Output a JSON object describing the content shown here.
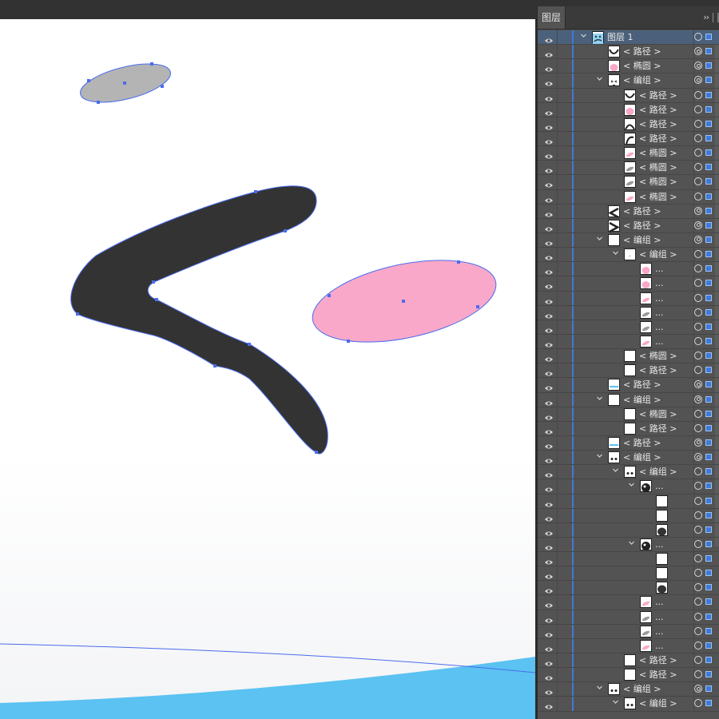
{
  "panel": {
    "tab_label": "图层",
    "menu_glyph": "››",
    "colors": {
      "selected_row": "#4b607a",
      "layer_color": "#3e7bd6",
      "panel_bg": "#535353"
    }
  },
  "canvas": {
    "colors": {
      "dark_stroke": "#333333",
      "pink_blush": "#f9a8c9",
      "gray_ellipse": "#b4b4b4",
      "sky_blue": "#5bc2f2",
      "path_outline": "#4a6cf0"
    }
  },
  "layers": [
    {
      "label": "图层 1",
      "indent": 0,
      "chev": "v",
      "thumb": "layer",
      "target": "single",
      "selected": true
    },
    {
      "label": "< 路径 >",
      "indent": 1,
      "chev": "",
      "thumb": "curve",
      "target": "double"
    },
    {
      "label": "< 椭圆 >",
      "indent": 1,
      "chev": "",
      "thumb": "pink",
      "target": "double"
    },
    {
      "label": "< 编组 >",
      "indent": 1,
      "chev": "v",
      "thumb": "face",
      "target": "double"
    },
    {
      "label": "< 路径 >",
      "indent": 2,
      "chev": "",
      "thumb": "curve",
      "target": "single"
    },
    {
      "label": "< 路径 >",
      "indent": 2,
      "chev": "",
      "thumb": "pink",
      "target": "single"
    },
    {
      "label": "< 路径 >",
      "indent": 2,
      "chev": "",
      "thumb": "arc",
      "target": "single"
    },
    {
      "label": "< 路径 >",
      "indent": 2,
      "chev": "",
      "thumb": "arc2",
      "target": "single"
    },
    {
      "label": "< 椭圆 >",
      "indent": 2,
      "chev": "",
      "thumb": "pinkslash",
      "target": "single"
    },
    {
      "label": "< 椭圆 >",
      "indent": 2,
      "chev": "",
      "thumb": "grayslash",
      "target": "single"
    },
    {
      "label": "< 椭圆 >",
      "indent": 2,
      "chev": "",
      "thumb": "grayslash",
      "target": "single"
    },
    {
      "label": "< 椭圆 >",
      "indent": 2,
      "chev": "",
      "thumb": "pinkslash",
      "target": "single"
    },
    {
      "label": "< 路径 >",
      "indent": 1,
      "chev": "",
      "thumb": "chevL",
      "target": "double"
    },
    {
      "label": "< 路径 >",
      "indent": 1,
      "chev": "",
      "thumb": "chevR",
      "target": "double"
    },
    {
      "label": "< 编组 >",
      "indent": 1,
      "chev": "v",
      "thumb": "blank",
      "target": "double"
    },
    {
      "label": "< 编组 >",
      "indent": 2,
      "chev": "v",
      "thumb": "dot",
      "target": "single"
    },
    {
      "label": "...",
      "indent": 3,
      "chev": "",
      "thumb": "pink",
      "target": "single"
    },
    {
      "label": "...",
      "indent": 3,
      "chev": "",
      "thumb": "pink",
      "target": "single"
    },
    {
      "label": "...",
      "indent": 3,
      "chev": "",
      "thumb": "pinkslash",
      "target": "single"
    },
    {
      "label": "...",
      "indent": 3,
      "chev": "",
      "thumb": "grayslash",
      "target": "single"
    },
    {
      "label": "...",
      "indent": 3,
      "chev": "",
      "thumb": "grayslash",
      "target": "single"
    },
    {
      "label": "...",
      "indent": 3,
      "chev": "",
      "thumb": "pinkslash",
      "target": "single"
    },
    {
      "label": "< 椭圆 >",
      "indent": 2,
      "chev": "",
      "thumb": "blank",
      "target": "single"
    },
    {
      "label": "< 路径 >",
      "indent": 2,
      "chev": "",
      "thumb": "blank",
      "target": "single"
    },
    {
      "label": "< 路径 >",
      "indent": 1,
      "chev": "",
      "thumb": "blue",
      "target": "double"
    },
    {
      "label": "< 编组 >",
      "indent": 1,
      "chev": "v",
      "thumb": "blank",
      "target": "double"
    },
    {
      "label": "< 椭圆 >",
      "indent": 2,
      "chev": "",
      "thumb": "blank",
      "target": "single"
    },
    {
      "label": "< 路径 >",
      "indent": 2,
      "chev": "",
      "thumb": "blank",
      "target": "single"
    },
    {
      "label": "< 路径 >",
      "indent": 1,
      "chev": "",
      "thumb": "blue",
      "target": "double"
    },
    {
      "label": "< 编组 >",
      "indent": 1,
      "chev": "v",
      "thumb": "eyes",
      "target": "double"
    },
    {
      "label": "< 编组 >",
      "indent": 2,
      "chev": "v",
      "thumb": "eyes",
      "target": "single"
    },
    {
      "label": "...",
      "indent": 3,
      "chev": "v",
      "thumb": "eyeball",
      "target": "single"
    },
    {
      "label": "",
      "indent": 4,
      "chev": "",
      "thumb": "blank",
      "target": "single"
    },
    {
      "label": "",
      "indent": 4,
      "chev": "",
      "thumb": "blank",
      "target": "single"
    },
    {
      "label": "",
      "indent": 4,
      "chev": "",
      "thumb": "darkoval",
      "target": "single"
    },
    {
      "label": "...",
      "indent": 3,
      "chev": "v",
      "thumb": "eyeball",
      "target": "single"
    },
    {
      "label": "",
      "indent": 4,
      "chev": "",
      "thumb": "blank",
      "target": "single"
    },
    {
      "label": "",
      "indent": 4,
      "chev": "",
      "thumb": "blank",
      "target": "single"
    },
    {
      "label": "",
      "indent": 4,
      "chev": "",
      "thumb": "darkoval",
      "target": "single"
    },
    {
      "label": "...",
      "indent": 3,
      "chev": "",
      "thumb": "pinkslash",
      "target": "single"
    },
    {
      "label": "...",
      "indent": 3,
      "chev": "",
      "thumb": "grayslash",
      "target": "single"
    },
    {
      "label": "...",
      "indent": 3,
      "chev": "",
      "thumb": "grayslash",
      "target": "single"
    },
    {
      "label": "...",
      "indent": 3,
      "chev": "",
      "thumb": "pinkslash",
      "target": "single"
    },
    {
      "label": "< 路径 >",
      "indent": 2,
      "chev": "",
      "thumb": "blank",
      "target": "single"
    },
    {
      "label": "< 路径 >",
      "indent": 2,
      "chev": "",
      "thumb": "blank",
      "target": "single"
    },
    {
      "label": "< 编组 >",
      "indent": 1,
      "chev": "v",
      "thumb": "eyes",
      "target": "double"
    },
    {
      "label": "< 编组 >",
      "indent": 2,
      "chev": "v",
      "thumb": "eyes",
      "target": "single"
    }
  ]
}
